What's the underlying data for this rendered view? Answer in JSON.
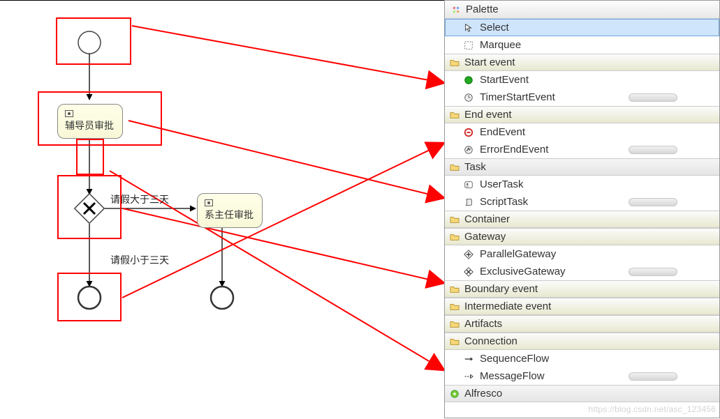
{
  "palette": {
    "title": "Palette",
    "tools": {
      "select": "Select",
      "marquee": "Marquee"
    },
    "groups": {
      "start_event": {
        "label": "Start event",
        "items": {
          "start": "StartEvent",
          "timer": "TimerStartEvent"
        }
      },
      "end_event": {
        "label": "End event",
        "items": {
          "end": "EndEvent",
          "error": "ErrorEndEvent"
        }
      },
      "task": {
        "label": "Task",
        "items": {
          "user": "UserTask",
          "script": "ScriptTask"
        }
      },
      "container": {
        "label": "Container"
      },
      "gateway": {
        "label": "Gateway",
        "items": {
          "parallel": "ParallelGateway",
          "exclusive": "ExclusiveGateway"
        }
      },
      "boundary_event": {
        "label": "Boundary event"
      },
      "intermediate_event": {
        "label": "Intermediate event"
      },
      "artifacts": {
        "label": "Artifacts"
      },
      "connection": {
        "label": "Connection",
        "items": {
          "sequence": "SequenceFlow",
          "message": "MessageFlow"
        }
      },
      "alfresco": {
        "label": "Alfresco"
      }
    }
  },
  "canvas": {
    "task1_label": "辅导员审批",
    "task2_label": "系主任审批",
    "edge_gt3_label": "请假大于三天",
    "edge_lt3_label": "请假小于三天"
  },
  "watermark": "https://blog.csdn.net/asc_123456"
}
